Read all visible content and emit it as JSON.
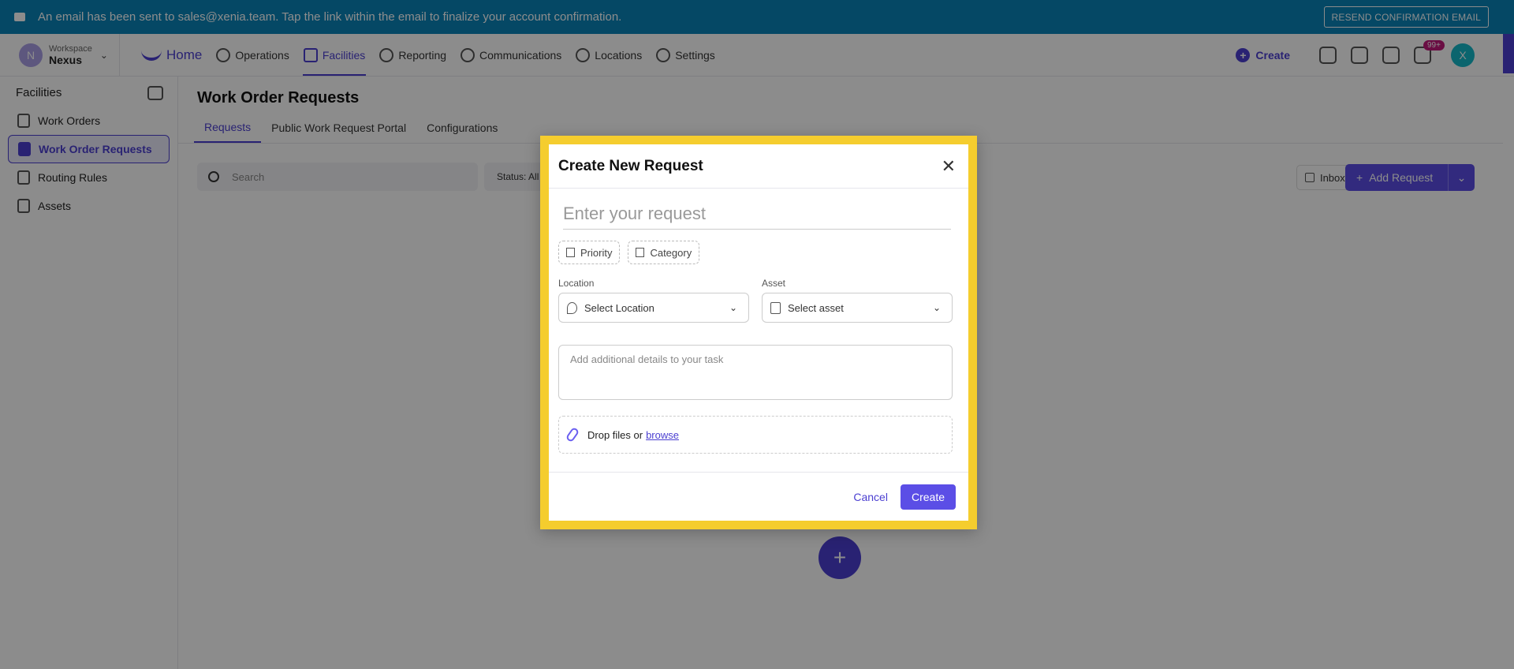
{
  "banner": {
    "message": "An email has been sent to sales@xenia.team. Tap the link within the email to finalize your account confirmation.",
    "resend_label": "RESEND CONFIRMATION EMAIL"
  },
  "workspace": {
    "label": "Workspace",
    "name": "Nexus",
    "initial": "N"
  },
  "nav": {
    "home": "Home",
    "items": [
      "Operations",
      "Facilities",
      "Reporting",
      "Communications",
      "Locations",
      "Settings"
    ]
  },
  "topright": {
    "create_label": "Create",
    "notification_badge": "99+",
    "avatar_initial": "X"
  },
  "sidebar": {
    "title": "Facilities",
    "items": [
      "Work Orders",
      "Work Order Requests",
      "Routing Rules",
      "Assets"
    ]
  },
  "main": {
    "title": "Work Order Requests",
    "tabs": [
      "Requests",
      "Public Work Request Portal",
      "Configurations"
    ],
    "search_placeholder": "Search",
    "status_label": "Status: All",
    "inbox_label": "Inbox",
    "add_request_label": "Add Request"
  },
  "modal": {
    "title": "Create New Request",
    "request_placeholder": "Enter your request",
    "priority_label": "Priority",
    "category_label": "Category",
    "location_label": "Location",
    "location_placeholder": "Select Location",
    "asset_label": "Asset",
    "asset_placeholder": "Select asset",
    "details_placeholder": "Add additional details to your task",
    "drop_text": "Drop files or",
    "browse_label": "browse",
    "cancel_label": "Cancel",
    "create_label": "Create"
  },
  "colors": {
    "accent": "#4b3fd1",
    "banner": "#0a84b8",
    "highlight": "#f5cd2e"
  }
}
